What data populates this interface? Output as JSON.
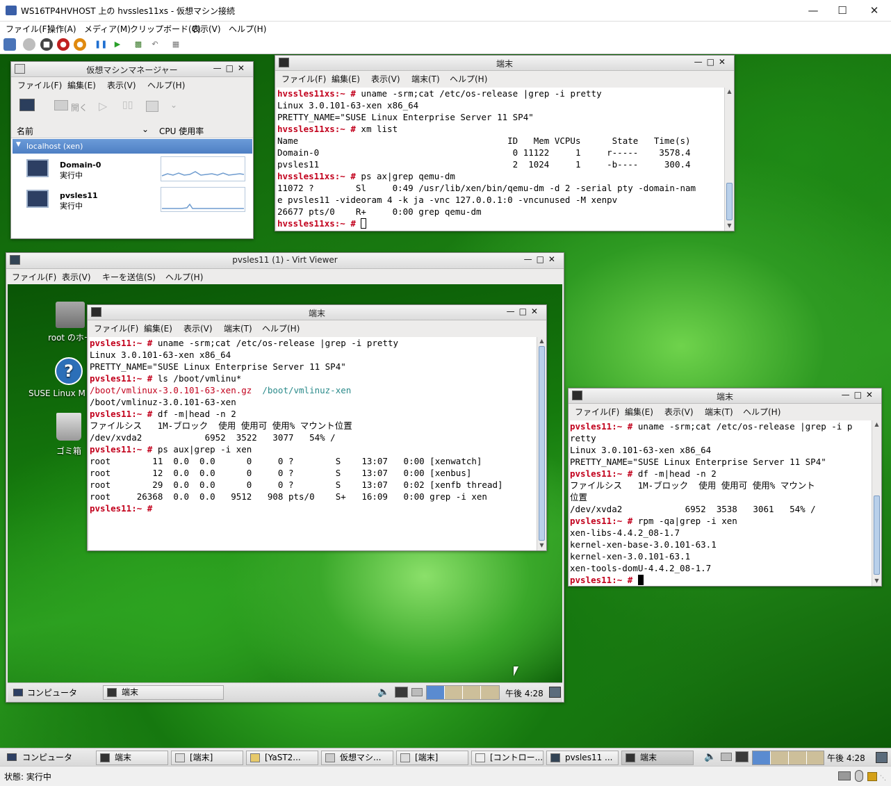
{
  "host": {
    "title": "WS16TP4HVHOST 上の hvssles11xs - 仮想マシン接続",
    "menu": [
      "ファイル(F)",
      "操作(A)",
      "メディア(M)",
      "クリップボード(C)",
      "表示(V)",
      "ヘルプ(H)"
    ],
    "status": "状態: 実行中"
  },
  "vmm": {
    "title": "仮想マシンマネージャー",
    "menu": [
      "ファイル(F)",
      "編集(E)",
      "表示(V)",
      "ヘルプ(H)"
    ],
    "open_label": "開く",
    "col_name": "名前",
    "col_cpu": "CPU 使用率",
    "group": "localhost (xen)",
    "vms": [
      {
        "name": "Domain-0",
        "state": "実行中"
      },
      {
        "name": "pvsles11",
        "state": "実行中"
      }
    ]
  },
  "term1": {
    "title": "端末",
    "menu": [
      "ファイル(F)",
      "編集(E)",
      "表示(V)",
      "端末(T)",
      "ヘルプ(H)"
    ],
    "prompt": "hvssles11xs:~ #",
    "lines": [
      {
        "p": "hvssles11xs:~ #",
        "t": " uname -srm;cat /etc/os-release |grep -i pretty"
      },
      {
        "t": "Linux 3.0.101-63-xen x86_64"
      },
      {
        "t": "PRETTY_NAME=\"SUSE Linux Enterprise Server 11 SP4\""
      },
      {
        "p": "hvssles11xs:~ #",
        "t": " xm list"
      },
      {
        "t": "Name                                        ID   Mem VCPUs      State   Time(s)"
      },
      {
        "t": "Domain-0                                     0 11122     1     r-----    3578.4"
      },
      {
        "t": "pvsles11                                     2  1024     1     -b----     300.4"
      },
      {
        "p": "hvssles11xs:~ #",
        "t": " ps ax|grep qemu-dm"
      },
      {
        "t": "11072 ?        Sl     0:49 /usr/lib/xen/bin/qemu-dm -d 2 -serial pty -domain-nam"
      },
      {
        "t": "e pvsles11 -videoram 4 -k ja -vnc 127.0.0.1:0 -vncunused -M xenpv"
      },
      {
        "t": "26677 pts/0    R+     0:00 grep qemu-dm"
      }
    ]
  },
  "viewer": {
    "title": "pvsles11 (1) - Virt Viewer",
    "menu": [
      "ファイル(F)",
      "表示(V)",
      "キーを送信(S)",
      "ヘルプ(H)"
    ],
    "desktop_icons": [
      "root のホー",
      "SUSE Linux M",
      "ゴミ箱"
    ],
    "panel_computer": "コンピュータ",
    "panel_task": "端末",
    "clock": "午後 4:28"
  },
  "term2": {
    "title": "端末",
    "menu": [
      "ファイル(F)",
      "編集(E)",
      "表示(V)",
      "端末(T)",
      "ヘルプ(H)"
    ],
    "prompt": "pvsles11:~ #",
    "lines": [
      {
        "p": "pvsles11:~ #",
        "t": " uname -srm;cat /etc/os-release |grep -i pretty"
      },
      {
        "t": "Linux 3.0.101-63-xen x86_64"
      },
      {
        "t": "PRETTY_NAME=\"SUSE Linux Enterprise Server 11 SP4\""
      },
      {
        "p": "pvsles11:~ #",
        "t": " ls /boot/vmlinu*"
      },
      {
        "r": "/boot/vmlinux-3.0.101-63-xen.gz",
        "g": "  /boot/vmlinuz-xen"
      },
      {
        "t": "/boot/vmlinuz-3.0.101-63-xen"
      },
      {
        "p": "pvsles11:~ #",
        "t": " df -m|head -n 2"
      },
      {
        "t": "ファイルシス   1M-ブロック  使用 使用可 使用% マウント位置"
      },
      {
        "t": "/dev/xvda2            6952  3522   3077   54% /"
      },
      {
        "p": "pvsles11:~ #",
        "t": " ps aux|grep -i xen"
      },
      {
        "t": "root        11  0.0  0.0      0     0 ?        S    13:07   0:00 [xenwatch]"
      },
      {
        "t": "root        12  0.0  0.0      0     0 ?        S    13:07   0:00 [xenbus]"
      },
      {
        "t": "root        29  0.0  0.0      0     0 ?        S    13:07   0:02 [xenfb thread]"
      },
      {
        "t": "root     26368  0.0  0.0   9512   908 pts/0    S+   16:09   0:00 grep -i xen"
      }
    ]
  },
  "term3": {
    "title": "端末",
    "menu": [
      "ファイル(F)",
      "編集(E)",
      "表示(V)",
      "端末(T)",
      "ヘルプ(H)"
    ],
    "prompt": "pvsles11:~ #",
    "lines": [
      {
        "p": "pvsles11:~ #",
        "t": " uname -srm;cat /etc/os-release |grep -i p"
      },
      {
        "t": "retty"
      },
      {
        "t": "Linux 3.0.101-63-xen x86_64"
      },
      {
        "t": "PRETTY_NAME=\"SUSE Linux Enterprise Server 11 SP4\""
      },
      {
        "p": "pvsles11:~ #",
        "t": " df -m|head -n 2"
      },
      {
        "t": "ファイルシス   1M-ブロック  使用 使用可 使用% マウント"
      },
      {
        "t": "位置"
      },
      {
        "t": "/dev/xvda2            6952  3538   3061   54% /"
      },
      {
        "p": "pvsles11:~ #",
        "t": " rpm -qa|grep -i xen"
      },
      {
        "t": "xen-libs-4.4.2_08-1.7"
      },
      {
        "t": "kernel-xen-base-3.0.101-63.1"
      },
      {
        "t": "kernel-xen-3.0.101-63.1"
      },
      {
        "t": "xen-tools-domU-4.4.2_08-1.7"
      }
    ]
  },
  "taskbar": {
    "computer": "コンピュータ",
    "tasks": [
      "端末",
      "[端末]",
      "[YaST2...",
      "仮想マシ...",
      "[端末]",
      "[コントロー...",
      "pvsles11 ...",
      "端末"
    ],
    "clock": "午後 4:28"
  }
}
